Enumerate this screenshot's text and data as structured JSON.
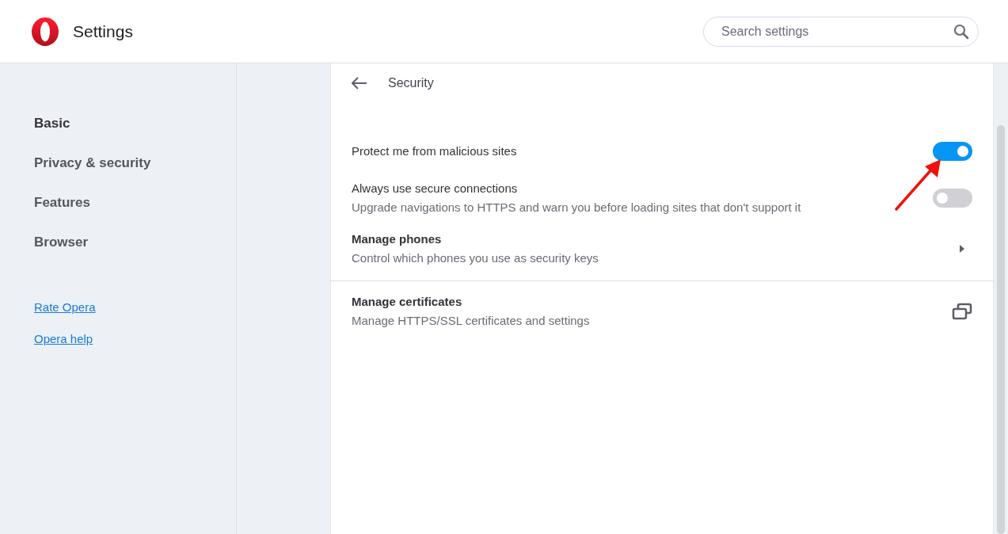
{
  "header": {
    "title": "Settings",
    "search": {
      "placeholder": "Search settings"
    }
  },
  "sidebar": {
    "items": [
      {
        "label": "Basic",
        "selected": true
      },
      {
        "label": "Privacy & security",
        "selected": false
      },
      {
        "label": "Features",
        "selected": false
      },
      {
        "label": "Browser",
        "selected": false
      }
    ],
    "links": [
      "Rate Opera",
      "Opera help"
    ]
  },
  "page": {
    "title": "Security",
    "sections": [
      {
        "rows": [
          {
            "kind": "toggle",
            "title": "Protect me from malicious sites",
            "on": true
          },
          {
            "kind": "toggle",
            "title": "Always use secure connections",
            "description": "Upgrade navigations to HTTPS and warn you before loading sites that don't support it",
            "on": false
          },
          {
            "kind": "submenu",
            "title": "Manage phones",
            "description": "Control which phones you use as security keys"
          }
        ]
      },
      {
        "rows": [
          {
            "kind": "external",
            "title": "Manage certificates",
            "description": "Manage HTTPS/SSL certificates and settings"
          }
        ]
      }
    ]
  }
}
